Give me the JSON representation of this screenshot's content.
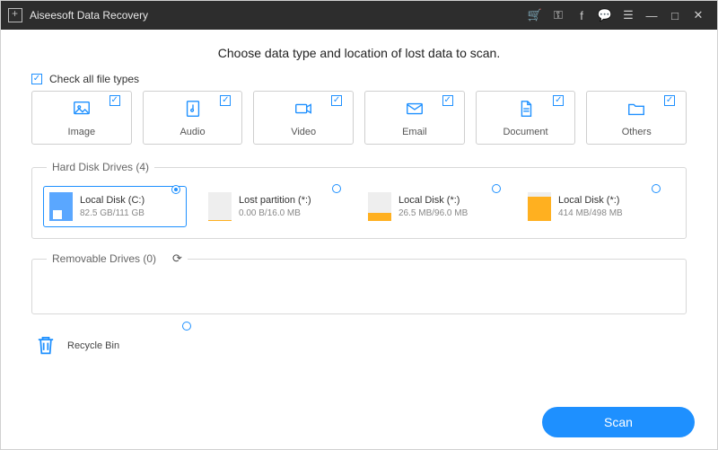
{
  "titlebar": {
    "app_name": "Aiseesoft Data Recovery"
  },
  "headline": "Choose data type and location of lost data to scan.",
  "checkall_label": "Check all file types",
  "file_types": [
    {
      "label": "Image"
    },
    {
      "label": "Audio"
    },
    {
      "label": "Video"
    },
    {
      "label": "Email"
    },
    {
      "label": "Document"
    },
    {
      "label": "Others"
    }
  ],
  "hdd": {
    "legend": "Hard Disk Drives (4)",
    "drives": [
      {
        "name": "Local Disk (C:)",
        "size": "82.5 GB/111 GB",
        "fill_pct": 74,
        "is_windows": true
      },
      {
        "name": "Lost partition (*:)",
        "size": "0.00  B/16.0 MB",
        "fill_pct": 2,
        "is_windows": false
      },
      {
        "name": "Local Disk (*:)",
        "size": "26.5 MB/96.0 MB",
        "fill_pct": 28,
        "is_windows": false
      },
      {
        "name": "Local Disk (*:)",
        "size": "414 MB/498 MB",
        "fill_pct": 83,
        "is_windows": false
      }
    ]
  },
  "removable": {
    "legend": "Removable Drives (0)"
  },
  "recycle": {
    "label": "Recycle Bin"
  },
  "scan_label": "Scan"
}
